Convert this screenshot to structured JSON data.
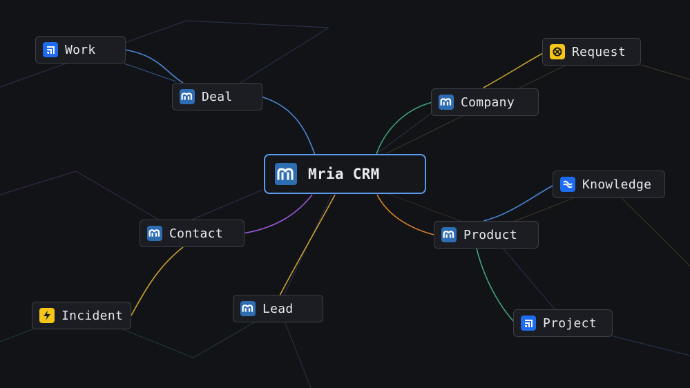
{
  "center": {
    "label": "Mria CRM",
    "icon": "mria-logo-icon"
  },
  "nodes": {
    "work": {
      "label": "Work",
      "icon": "jira-icon"
    },
    "deal": {
      "label": "Deal",
      "icon": "mria-logo-icon"
    },
    "contact": {
      "label": "Contact",
      "icon": "mria-logo-icon"
    },
    "incident": {
      "label": "Incident",
      "icon": "bolt-icon"
    },
    "lead": {
      "label": "Lead",
      "icon": "mria-logo-icon"
    },
    "company": {
      "label": "Company",
      "icon": "mria-logo-icon"
    },
    "request": {
      "label": "Request",
      "icon": "lifebuoy-icon"
    },
    "knowledge": {
      "label": "Knowledge",
      "icon": "confluence-icon"
    },
    "product": {
      "label": "Product",
      "icon": "mria-logo-icon"
    },
    "project": {
      "label": "Project",
      "icon": "jira-icon"
    }
  },
  "colors": {
    "background": "#121316",
    "center_border": "#5b9cf0",
    "mria_blue": "#2f6db3",
    "jira_blue": "#1f6bf0",
    "yellow": "#f5c518",
    "edge_blue": "#4a86d6",
    "edge_green": "#3fa37a",
    "edge_yellow": "#c9a233",
    "edge_orange": "#d9822b",
    "edge_purple": "#9a58d6"
  }
}
